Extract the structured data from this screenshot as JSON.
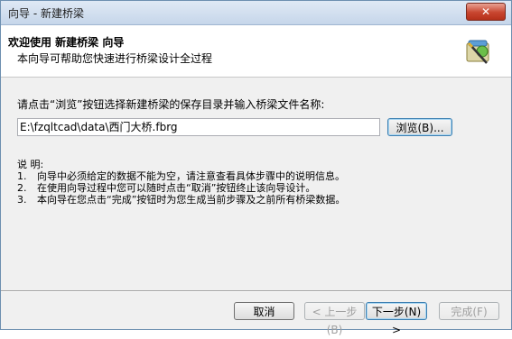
{
  "window": {
    "title": "向导 - 新建桥梁",
    "close_label": "✕"
  },
  "header": {
    "title": "欢迎使用 新建桥梁 向导",
    "subtitle": "本向导可帮助您快速进行桥梁设计全过程",
    "icon": "wizard-icon"
  },
  "main": {
    "prompt": "请点击“浏览”按钮选择新建桥梁的保存目录并输入桥梁文件名称:",
    "path_value": "E:\\fzqltcad\\data\\西门大桥.fbrg",
    "browse_label": "浏览(B)..."
  },
  "notes": {
    "heading": "说 明:",
    "items": [
      {
        "num": "1.",
        "text": "向导中必须给定的数据不能为空，请注意查看具体步骤中的说明信息。"
      },
      {
        "num": "2.",
        "text": "在使用向导过程中您可以随时点击“取消”按钮终止该向导设计。"
      },
      {
        "num": "3.",
        "text": "本向导在您点击“完成”按钮时为您生成当前步骤及之前所有桥梁数据。"
      }
    ]
  },
  "footer": {
    "cancel_label": "取消",
    "back_label": "< 上一步(B)",
    "next_label": "下一步(N) >",
    "finish_label": "完成(F)"
  }
}
